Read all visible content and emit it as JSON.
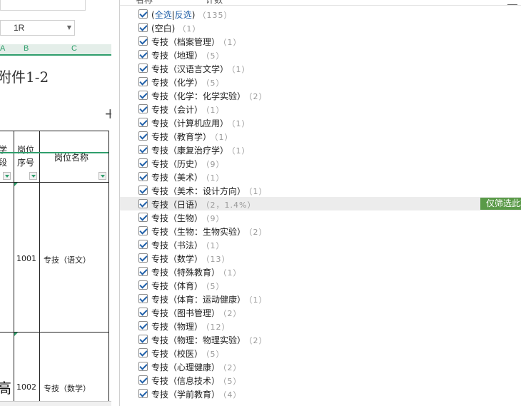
{
  "sheet": {
    "name_box_value": "1R",
    "column_letters": [
      "A",
      "B",
      "C"
    ],
    "title_text": "附件1-2",
    "header": {
      "col_a_line1": "学",
      "col_a_line2": "段",
      "col_b_line1": "岗位",
      "col_b_line2": "序号",
      "col_c": "岗位名称"
    },
    "rows": [
      {
        "seq": "1001",
        "name": "专技（语文）"
      },
      {
        "seq": "1002",
        "name": "专技（数学）"
      }
    ],
    "left_glyph": "高"
  },
  "panel": {
    "header": {
      "name_tab": "名称",
      "count_tab": "计数"
    },
    "select_all": {
      "label_all": "全选",
      "sep": "|",
      "label_invert": "反选",
      "count": "（135）"
    },
    "only_filter_label": "仅筛选此项",
    "items": [
      {
        "label": "(空白)",
        "count": "（1）"
      },
      {
        "label": "专技（档案管理）",
        "count": "（1）"
      },
      {
        "label": "专技（地理）",
        "count": "（5）"
      },
      {
        "label": "专技（汉语言文学）",
        "count": "（1）"
      },
      {
        "label": "专技（化学）",
        "count": "（5）"
      },
      {
        "label": "专技（化学：化学实验）",
        "count": "（2）"
      },
      {
        "label": "专技（会计）",
        "count": "（1）"
      },
      {
        "label": "专技（计算机应用）",
        "count": "（1）"
      },
      {
        "label": "专技（教育学）",
        "count": "（1）"
      },
      {
        "label": "专技（康复治疗学）",
        "count": "（1）"
      },
      {
        "label": "专技（历史）",
        "count": "（9）"
      },
      {
        "label": "专技（美术）",
        "count": "（1）"
      },
      {
        "label": "专技（美术：设计方向）",
        "count": "（1）"
      },
      {
        "label": "专技（日语）",
        "count": "（2，1.4%）"
      },
      {
        "label": "专技（生物）",
        "count": "（9）"
      },
      {
        "label": "专技（生物：生物实验）",
        "count": "（2）"
      },
      {
        "label": "专技（书法）",
        "count": "（1）"
      },
      {
        "label": "专技（数学）",
        "count": "（13）"
      },
      {
        "label": "专技（特殊教育）",
        "count": "（1）"
      },
      {
        "label": "专技（体育）",
        "count": "（5）"
      },
      {
        "label": "专技（体育：运动健康）",
        "count": "（1）"
      },
      {
        "label": "专技（图书管理）",
        "count": "（2）"
      },
      {
        "label": "专技（物理）",
        "count": "（12）"
      },
      {
        "label": "专技（物理：物理实验）",
        "count": "（2）"
      },
      {
        "label": "专技（校医）",
        "count": "（5）"
      },
      {
        "label": "专技（心理健康）",
        "count": "（2）"
      },
      {
        "label": "专技（信息技术）",
        "count": "（5）"
      },
      {
        "label": "专技（学前教育）",
        "count": "（4）"
      }
    ]
  }
}
